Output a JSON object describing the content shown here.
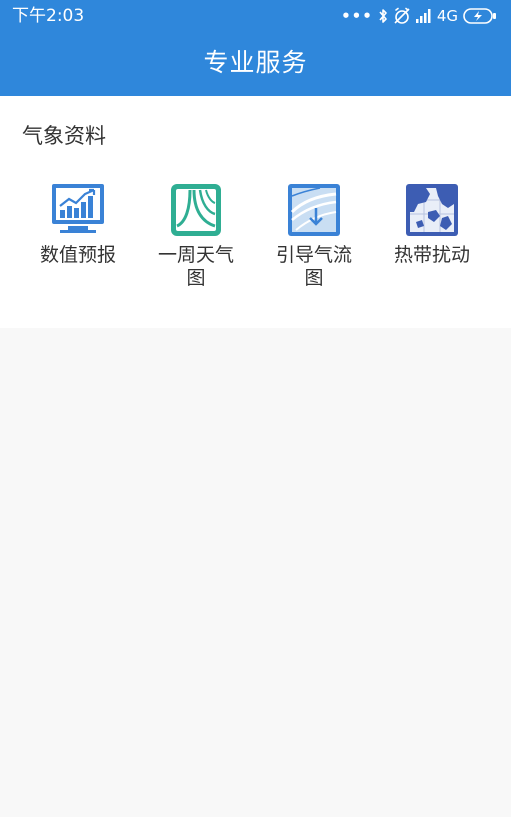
{
  "status_bar": {
    "time": "下午2:03",
    "network": "4G",
    "icons": [
      "more-dots-icon",
      "bluetooth-icon",
      "mute-alarm-icon",
      "signal-icon",
      "battery-charging-icon"
    ]
  },
  "header": {
    "title": "专业服务"
  },
  "section": {
    "title": "气象资料",
    "items": [
      {
        "label": "数值预报",
        "icon": "chart-monitor-icon"
      },
      {
        "label": "一周天气图",
        "icon": "weather-chart-icon"
      },
      {
        "label": "引导气流图",
        "icon": "steering-flow-icon"
      },
      {
        "label": "热带扰动",
        "icon": "tropical-map-icon"
      }
    ]
  },
  "colors": {
    "header": "#2f87db",
    "page_background": "#f8f8f8",
    "card_background": "#ffffff",
    "icon_blue": "#3a82d6",
    "icon_teal": "#2fae93"
  }
}
